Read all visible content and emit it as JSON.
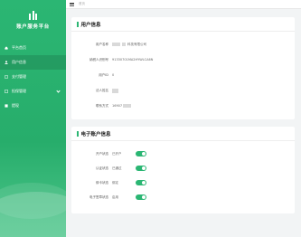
{
  "sidebar": {
    "title": "账户服务平台",
    "items": [
      {
        "label": "平台首页",
        "active": false,
        "has_children": false
      },
      {
        "label": "用户信息",
        "active": true,
        "has_children": false
      },
      {
        "label": "支付管理",
        "active": false,
        "has_children": false
      },
      {
        "label": "担保管理",
        "active": false,
        "has_children": true
      },
      {
        "label": "提现",
        "active": false,
        "has_children": false
      }
    ]
  },
  "topbar": {
    "breadcrumb": "首页"
  },
  "user_info": {
    "title": "用户信息",
    "fields": [
      {
        "label": "用户名称",
        "value": "科技有限公司"
      },
      {
        "label": "纳税人识别号",
        "value": "91330701MA2HYWLCA6N"
      },
      {
        "label": "用户ID",
        "value": "0"
      },
      {
        "label": "法人姓名",
        "value": ""
      },
      {
        "label": "联系方式",
        "value": "16907"
      }
    ]
  },
  "account_info": {
    "title": "电子账户信息",
    "fields": [
      {
        "label": "开户状态",
        "value": "已开户",
        "enabled": true
      },
      {
        "label": "认证状态",
        "value": "已通过",
        "enabled": true
      },
      {
        "label": "绑卡状态",
        "value": "绑定",
        "enabled": true
      },
      {
        "label": "电子签章状态",
        "value": "启用",
        "enabled": true
      }
    ]
  },
  "colors": {
    "accent": "#2bb673",
    "page_bg": "#f2f4f5"
  }
}
